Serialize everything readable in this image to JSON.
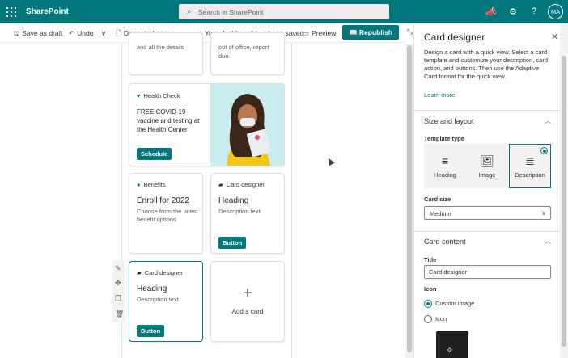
{
  "suitebar": {
    "app_name": "SharePoint",
    "search_placeholder": "Search in SharePoint",
    "avatar_initials": "MA"
  },
  "commandbar": {
    "save_draft": "Save as draft",
    "undo": "Undo",
    "discard": "Discard changes",
    "more": "···",
    "status": "Your dashboard has been saved",
    "preview": "Preview",
    "republish": "Republish"
  },
  "cards": {
    "top_left_partial": "and all the details",
    "top_right_partial_1": "out of office, report",
    "top_right_partial_2": "due",
    "health": {
      "header": "Health Check",
      "title": "FREE COVID-19 vaccine and testing at the Health Center",
      "button": "Schedule"
    },
    "benefits": {
      "header": "Benefits",
      "title": "Enroll for 2022",
      "desc": "Choose from the latest benefit options"
    },
    "designer1": {
      "header": "Card designer",
      "title": "Heading",
      "desc": "Description text",
      "button": "Button"
    },
    "designer2": {
      "header": "Card designer",
      "title": "Heading",
      "desc": "Description text",
      "button": "Button"
    },
    "add": {
      "label": "Add a card"
    }
  },
  "panel": {
    "title": "Card designer",
    "description": "Design a card with a quick view. Select a card template and customize your description, card action, and buttons. Then use the Adaptive Card format for the quick view.",
    "learn_more": "Learn more",
    "section_size": "Size and layout",
    "template_type_label": "Template type",
    "templates": [
      "Heading",
      "Image",
      "Description"
    ],
    "selected_template": "Description",
    "card_size_label": "Card size",
    "card_size_value": "Medium",
    "section_content": "Card content",
    "title_label": "Title",
    "title_value": "Card designer",
    "icon_label": "Icon",
    "icon_options": [
      "Custom image",
      "Icon"
    ],
    "icon_selected": "Custom image"
  },
  "colors": {
    "brand": "#03787c",
    "suitebar": "#03787c"
  }
}
